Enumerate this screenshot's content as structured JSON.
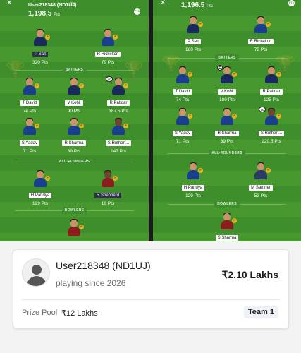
{
  "left_panel": {
    "username": "User218348 (ND1UJ)",
    "team_tag": "T1",
    "points": "1,198.5",
    "points_unit": "Pts",
    "pts_icon_text": "PTS",
    "sections": {
      "batters": "BATTERS",
      "all_rounders": "ALL-ROUNDERS",
      "bowlers": "BOWLERS"
    },
    "players": [
      {
        "name": "P Salt",
        "pts": "320 Pts"
      },
      {
        "name": "R Rickelton",
        "pts": "79 Pts"
      },
      {
        "name": "T David",
        "pts": "74 Pts"
      },
      {
        "name": "V Kohli",
        "pts": "90 Pts"
      },
      {
        "name": "R Patidar",
        "pts": "187.5 Pts"
      },
      {
        "name": "S Yadav",
        "pts": "71 Pts"
      },
      {
        "name": "R Sharma",
        "pts": "39 Pts"
      },
      {
        "name": "S Rutherf...",
        "pts": "147 Pts"
      },
      {
        "name": "H Pandya",
        "pts": "129 Pts"
      },
      {
        "name": "R Shepherd",
        "pts": "16 Pts"
      }
    ],
    "captain_label": "C",
    "vice_captain_label": "VC"
  },
  "right_panel": {
    "points": "1,196.5",
    "points_unit": "Pts",
    "pts_icon_text": "PTS",
    "sections": {
      "batters": "BATTERS",
      "all_rounders": "ALL-ROUNDERS",
      "bowlers": "BOWLERS"
    },
    "players": [
      {
        "name": "P Salt",
        "pts": "160 Pts"
      },
      {
        "name": "R Rickelton",
        "pts": "79 Pts"
      },
      {
        "name": "T David",
        "pts": "74 Pts"
      },
      {
        "name": "V Kohli",
        "pts": "180 Pts"
      },
      {
        "name": "R Patidar",
        "pts": "125 Pts"
      },
      {
        "name": "S Yadav",
        "pts": "71 Pts"
      },
      {
        "name": "R Sharma",
        "pts": "39 Pts"
      },
      {
        "name": "S Rutherf...",
        "pts": "220.5 Pts"
      },
      {
        "name": "H Pandya",
        "pts": "129 Pts"
      },
      {
        "name": "M Santner",
        "pts": "53 Pts"
      },
      {
        "name": "S Sharma",
        "pts": ""
      }
    ],
    "captain_label": "C",
    "vice_captain_label": "VC"
  },
  "player_badge": "P",
  "card": {
    "username": "User218348 (ND1UJ)",
    "playing_since": "playing since 2026",
    "winnings": "₹2.10 Lakhs",
    "prize_pool_label": "Prize Pool",
    "prize_pool_value": "₹12 Lakhs",
    "team_label": "Team 1"
  },
  "colors": {
    "pitch": "#3e8f2c",
    "light_tag": "#ffffff",
    "dark_tag": "#2b3345",
    "player_badge": "#e5b327"
  }
}
